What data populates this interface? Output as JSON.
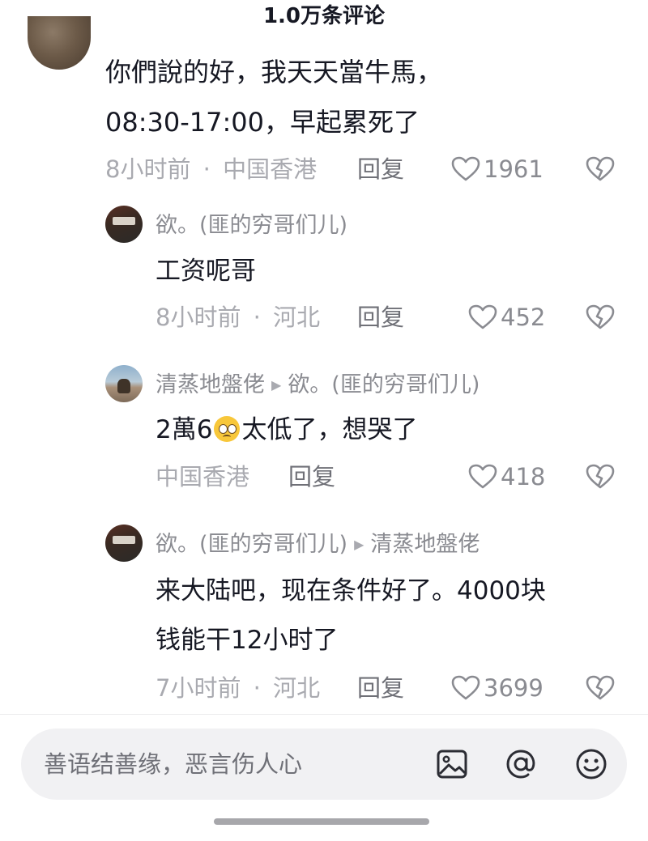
{
  "header": {
    "title": "1.0万条评论"
  },
  "comments": [
    {
      "lines": [
        "你們說的好，我天天當牛馬，",
        "08:30-17:00，早起累死了"
      ],
      "time": "8小时前",
      "location": "中国香港",
      "reply_label": "回复",
      "likes": "1961"
    }
  ],
  "replies": [
    {
      "username": "欲。(匪的穷哥们儿)",
      "text": "工资呢哥",
      "time": "8小时前",
      "location": "河北",
      "reply_label": "回复",
      "likes": "452"
    },
    {
      "username": "清蒸地盤佬",
      "reply_to": "欲。(匪的穷哥们儿)",
      "text_before_emoji": "2萬6",
      "text_after_emoji": "太低了，想哭了",
      "location": "中国香港",
      "reply_label": "回复",
      "likes": "418"
    },
    {
      "username": "欲。(匪的穷哥们儿)",
      "reply_to": "清蒸地盤佬",
      "lines": [
        "来大陆吧，现在条件好了。4000块",
        "钱能干12小时了"
      ],
      "time": "7小时前",
      "location": "河北",
      "reply_label": "回复",
      "likes": "3699"
    }
  ],
  "meta_separator": "·",
  "input": {
    "placeholder": "善语结善缘，恶言伤人心"
  },
  "icons": {
    "like": "heart-outline-icon",
    "dislike": "broken-heart-icon",
    "image": "image-icon",
    "mention": "at-sign-icon",
    "emoji": "smiley-icon",
    "reply_arrow": "triangle-right-icon"
  },
  "colors": {
    "primary_text": "#161823",
    "secondary_text": "#8a8b91",
    "meta_text": "#a9aab0",
    "input_background": "#f1f1f3"
  }
}
